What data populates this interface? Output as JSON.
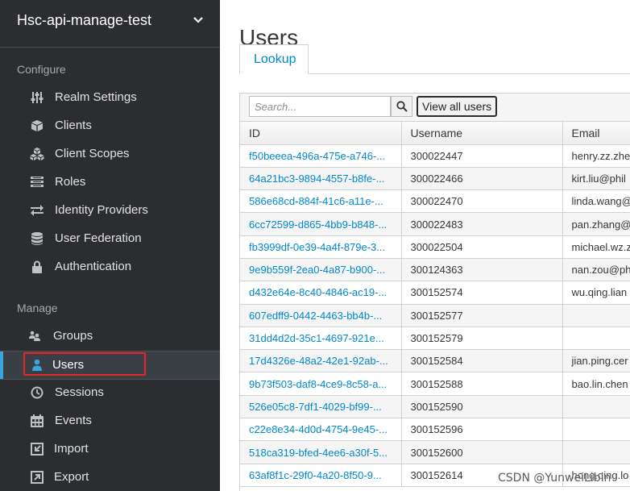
{
  "realm": {
    "name": "Hsc-api-manage-test"
  },
  "sections": {
    "configure": "Configure",
    "manage": "Manage"
  },
  "configure_items": [
    {
      "label": "Realm Settings",
      "icon": "sliders-icon"
    },
    {
      "label": "Clients",
      "icon": "cube-icon"
    },
    {
      "label": "Client Scopes",
      "icon": "cubes-icon"
    },
    {
      "label": "Roles",
      "icon": "list-icon"
    },
    {
      "label": "Identity Providers",
      "icon": "exchange-icon"
    },
    {
      "label": "User Federation",
      "icon": "database-icon"
    },
    {
      "label": "Authentication",
      "icon": "lock-icon"
    }
  ],
  "manage_items": [
    {
      "label": "Groups",
      "icon": "users-icon"
    },
    {
      "label": "Users",
      "icon": "user-icon",
      "active": true
    },
    {
      "label": "Sessions",
      "icon": "clock-icon"
    },
    {
      "label": "Events",
      "icon": "calendar-icon"
    },
    {
      "label": "Import",
      "icon": "import-icon"
    },
    {
      "label": "Export",
      "icon": "export-icon"
    }
  ],
  "main": {
    "title": "Users",
    "tab": "Lookup",
    "search_placeholder": "Search...",
    "view_all_label": "View all users"
  },
  "table": {
    "columns": [
      "ID",
      "Username",
      "Email"
    ],
    "rows": [
      {
        "id": "f50beeea-496a-475e-a746-...",
        "username": "300022447",
        "email": "henry.zz.zhe"
      },
      {
        "id": "64a21bc3-9894-4557-b8fe-...",
        "username": "300022466",
        "email": "kirt.liu@phil"
      },
      {
        "id": "586e68cd-884f-41c6-a11e-...",
        "username": "300022470",
        "email": "linda.wang@"
      },
      {
        "id": "6cc72599-d865-4bb9-b848-...",
        "username": "300022483",
        "email": "pan.zhang@"
      },
      {
        "id": "fb3999df-0e39-4a4f-879e-3...",
        "username": "300022504",
        "email": "michael.wz.z"
      },
      {
        "id": "9e9b559f-2ea0-4a87-b900-...",
        "username": "300124363",
        "email": "nan.zou@ph"
      },
      {
        "id": "d432e64e-8c40-4846-ac19-...",
        "username": "300152574",
        "email": "wu.qing.lian"
      },
      {
        "id": "607edff9-0442-4463-bb4b-...",
        "username": "300152577",
        "email": ""
      },
      {
        "id": "31dd4d2d-35c1-4697-921e...",
        "username": "300152579",
        "email": ""
      },
      {
        "id": "17d4326e-48a2-42e1-92ab-...",
        "username": "300152584",
        "email": "jian.ping.cer"
      },
      {
        "id": "9b73f503-daf8-4ce9-8c58-a...",
        "username": "300152588",
        "email": "bao.lin.chen"
      },
      {
        "id": "526e05c8-7df1-4029-bf99-...",
        "username": "300152590",
        "email": ""
      },
      {
        "id": "c22e8e34-4d0d-4754-9e45-...",
        "username": "300152596",
        "email": ""
      },
      {
        "id": "518ca319-bfed-4ee6-a30f-5...",
        "username": "300152600",
        "email": ""
      },
      {
        "id": "63af8f1c-29f0-4a20-8f50-9...",
        "username": "300152614",
        "email": "hong.qing.lo"
      }
    ]
  },
  "watermark": "CSDN @YunweiLibin",
  "colors": {
    "sidebar_bg": "#2b2d30",
    "link": "#0088ce",
    "active_bar": "#39a5dc",
    "highlight": "#e8262a"
  }
}
